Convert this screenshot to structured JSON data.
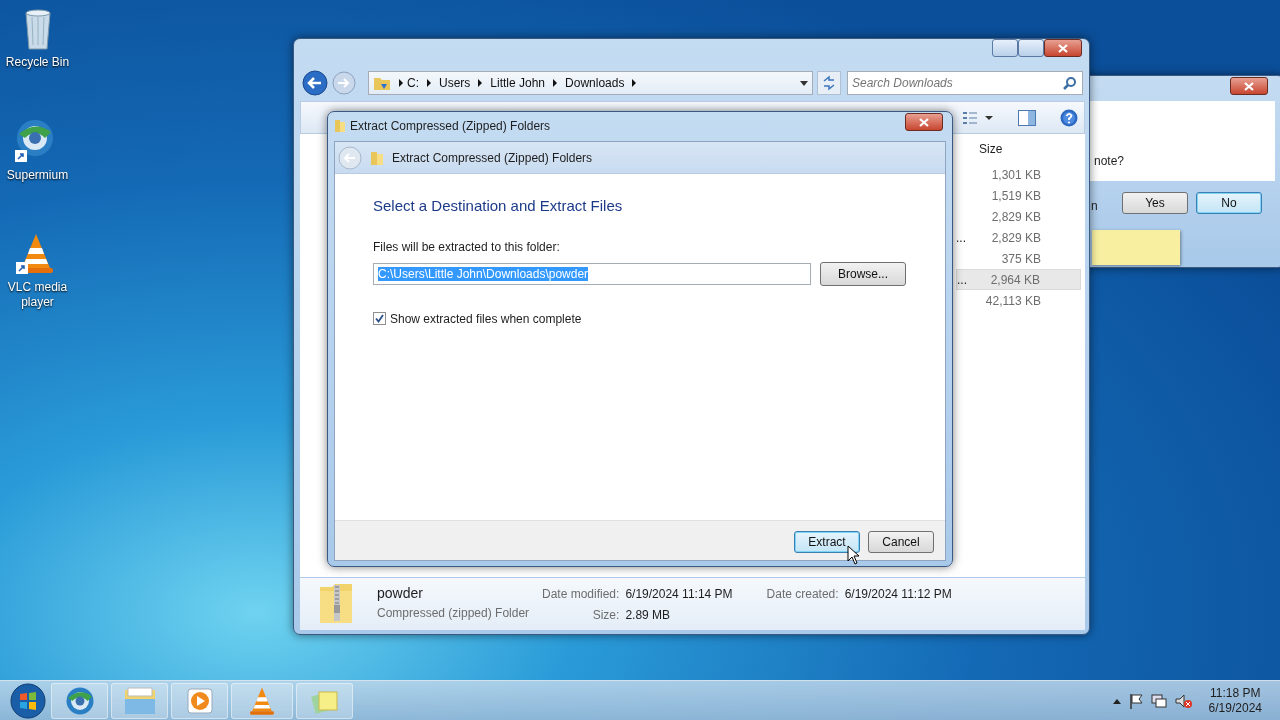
{
  "desktop_icons": [
    {
      "label": "Recycle Bin"
    },
    {
      "label": "Supermium"
    },
    {
      "label": "VLC media player"
    }
  ],
  "message_box": {
    "question": "note?",
    "fragment": "n",
    "buttons": [
      {
        "label": "Yes",
        "focused": false
      },
      {
        "label": "No",
        "focused": true
      }
    ]
  },
  "explorer": {
    "breadcrumb": [
      "C:",
      "Users",
      "Little John",
      "Downloads"
    ],
    "search": {
      "placeholder": "Search Downloads"
    },
    "column": "Size",
    "rows": [
      {
        "size": "1,301 KB",
        "selected": false
      },
      {
        "size": "1,519 KB",
        "selected": false
      },
      {
        "size": "2,829 KB",
        "selected": false
      },
      {
        "name_tail": "...",
        "size": "2,829 KB",
        "selected": false
      },
      {
        "size": "375 KB",
        "selected": false
      },
      {
        "name_tail": "...",
        "size": "2,964 KB",
        "selected": true
      },
      {
        "size": "42,113 KB",
        "selected": false
      }
    ],
    "details": {
      "name": "powder",
      "type": "Compressed (zipped) Folder",
      "fields": [
        {
          "label": "Date modified:",
          "value": "6/19/2024 11:14 PM"
        },
        {
          "label": "Size:",
          "value": "2.89 MB"
        },
        {
          "label": "Date created:",
          "value": "6/19/2024 11:12 PM"
        }
      ]
    }
  },
  "extract_dialog": {
    "title": "Extract Compressed (Zipped) Folders",
    "header": "Extract Compressed (Zipped) Folders",
    "heading": "Select a Destination and Extract Files",
    "label": "Files will be extracted to this folder:",
    "path": {
      "value": "C:\\Users\\Little John\\Downloads\\powder",
      "selected": true
    },
    "browse": "Browse...",
    "checkbox": {
      "label": "Show extracted files when complete",
      "checked": true
    },
    "buttons": [
      {
        "label": "Extract",
        "focused": true
      },
      {
        "label": "Cancel",
        "focused": false
      }
    ]
  },
  "clock": {
    "time": "11:18 PM",
    "date": "6/19/2024"
  }
}
